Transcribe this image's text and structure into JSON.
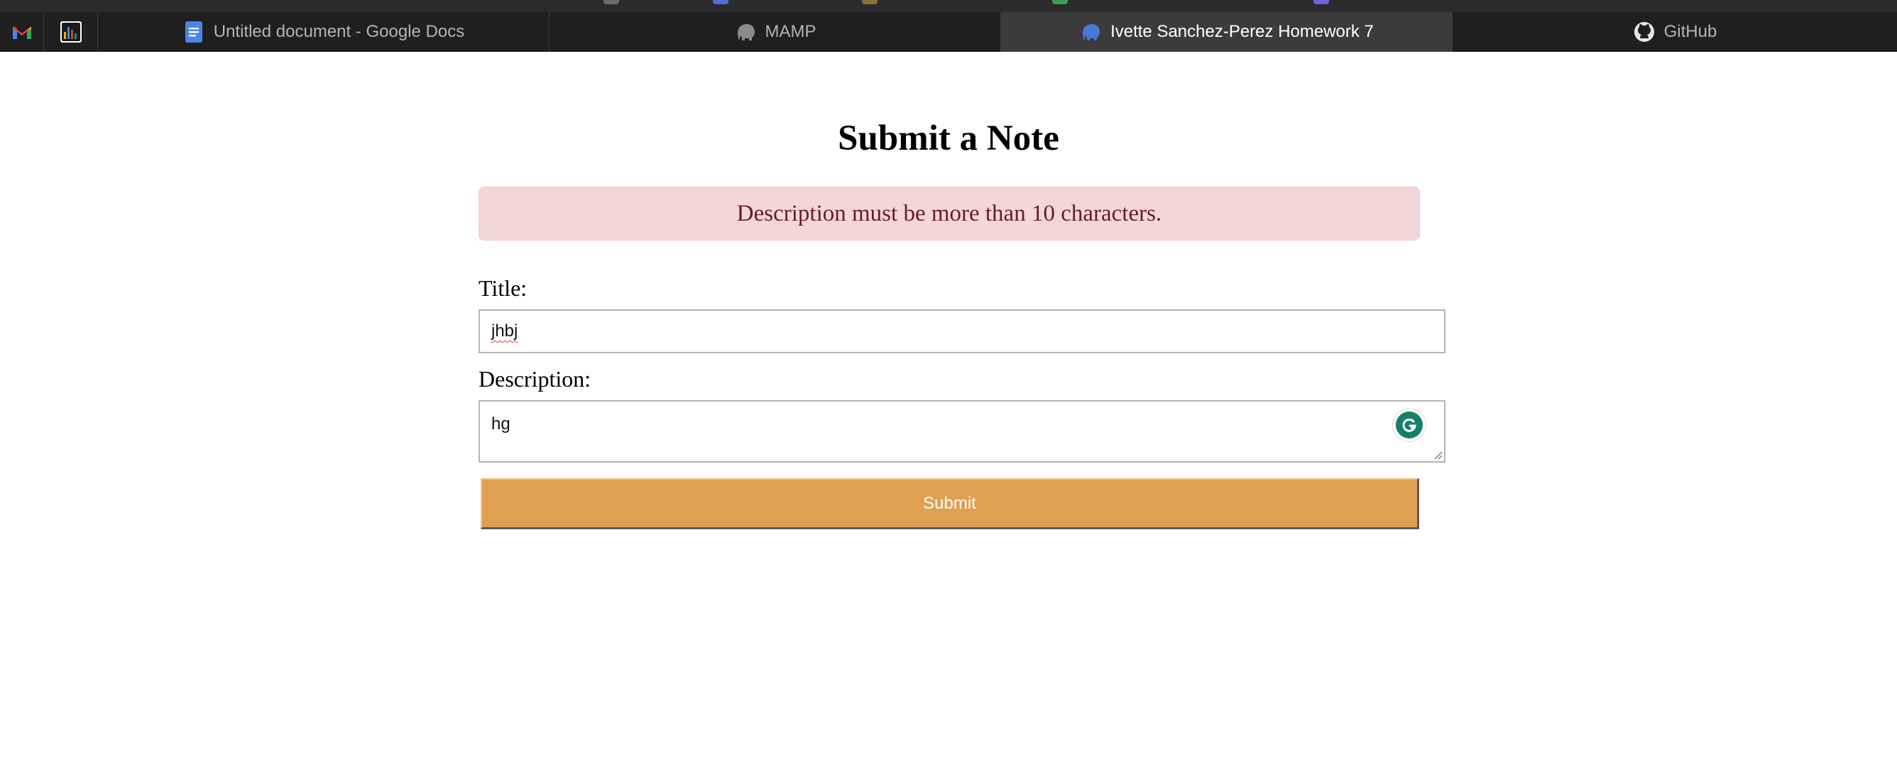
{
  "browser": {
    "tabs": [
      {
        "label": "Untitled document - Google Docs",
        "icon": "docs-icon"
      },
      {
        "label": "MAMP",
        "icon": "elephant-icon"
      },
      {
        "label": "Ivette Sanchez-Perez Homework 7",
        "icon": "elephant-icon",
        "active": true
      },
      {
        "label": "GitHub",
        "icon": "github-icon"
      }
    ],
    "pinned": [
      {
        "icon": "gmail-icon"
      },
      {
        "icon": "analytics-icon"
      }
    ]
  },
  "page": {
    "heading": "Submit a Note",
    "alert": {
      "message": "Description must be more than 10 characters.",
      "background": "#f3d6d8",
      "color": "#6b1a25"
    },
    "form": {
      "title_label": "Title:",
      "title_value": "jhbj",
      "description_label": "Description:",
      "description_value": "hg",
      "submit_label": "Submit",
      "submit_color": "#e0a052"
    }
  }
}
